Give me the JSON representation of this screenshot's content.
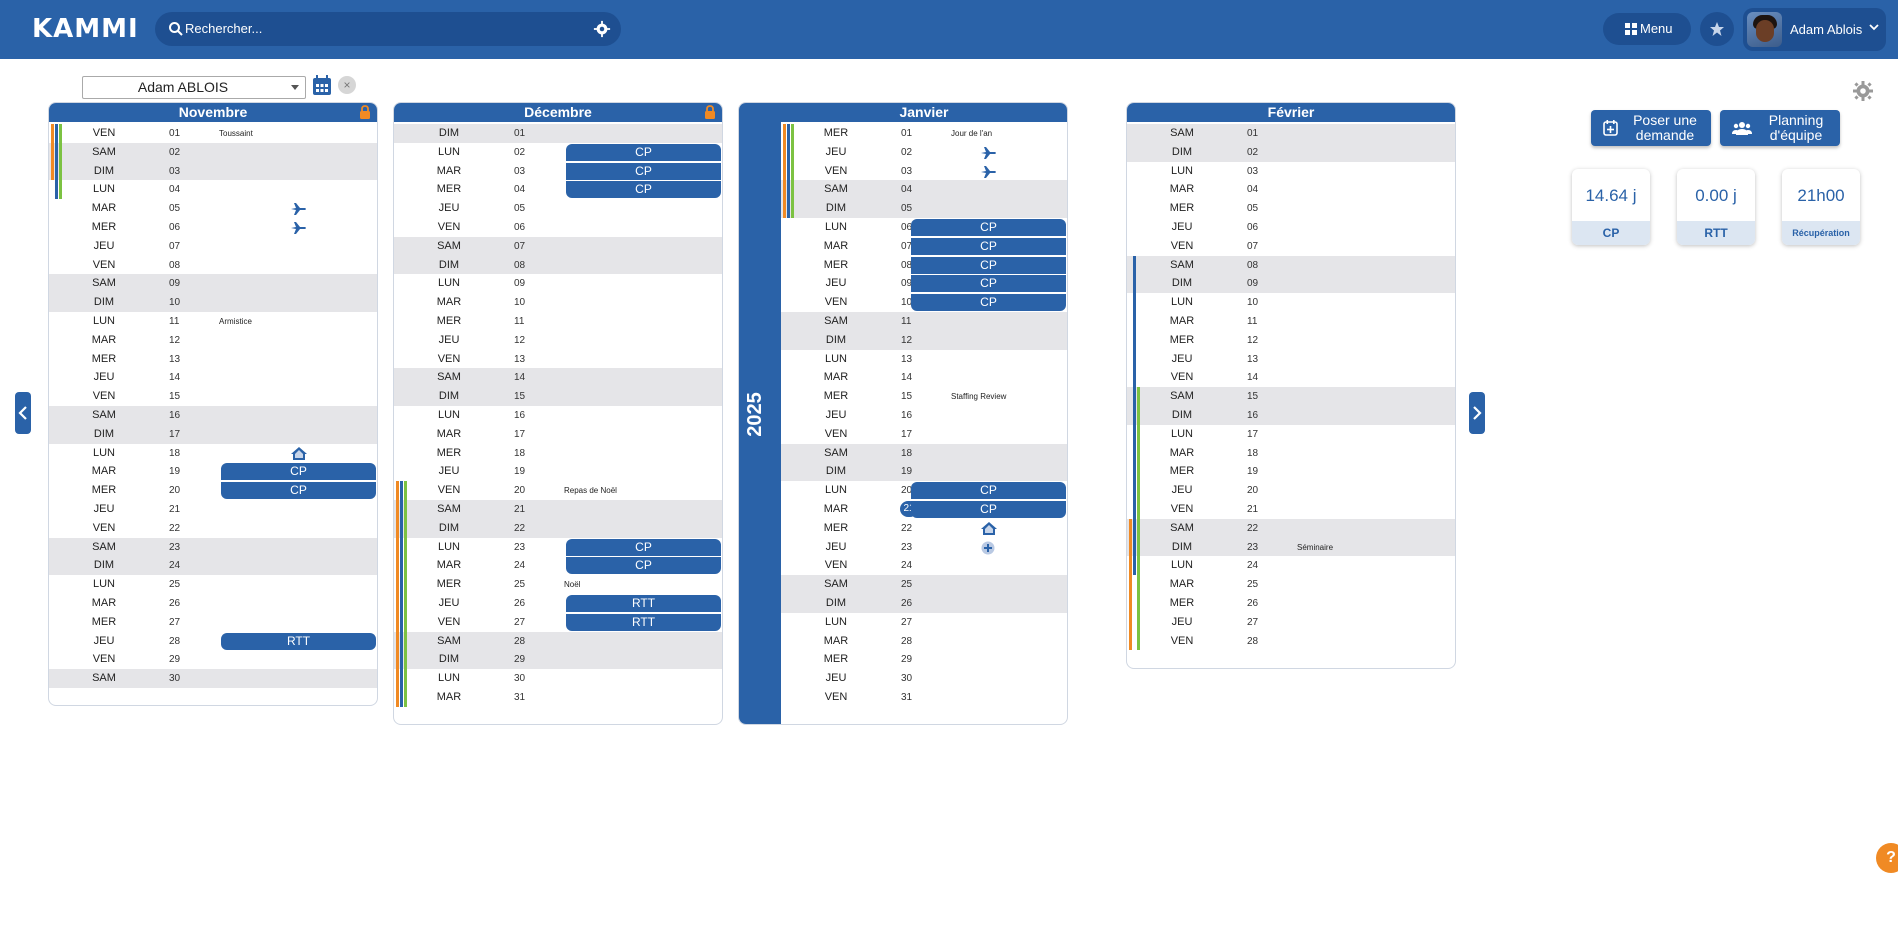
{
  "header": {
    "logo": "KAMMI",
    "search_placeholder": "Rechercher...",
    "menu_label": "Menu",
    "user_name": "Adam Ablois"
  },
  "controls": {
    "selected_person": "Adam ABLOIS"
  },
  "year_label": "2025",
  "months": [
    {
      "name": "Novembre",
      "locked": true,
      "days": [
        [
          "VEN",
          "01",
          "Toussaint"
        ],
        [
          "SAM",
          "02",
          ""
        ],
        [
          "DIM",
          "03",
          ""
        ],
        [
          "LUN",
          "04",
          ""
        ],
        [
          "MAR",
          "05",
          ""
        ],
        [
          "MER",
          "06",
          ""
        ],
        [
          "JEU",
          "07",
          ""
        ],
        [
          "VEN",
          "08",
          ""
        ],
        [
          "SAM",
          "09",
          ""
        ],
        [
          "DIM",
          "10",
          ""
        ],
        [
          "LUN",
          "11",
          "Armistice"
        ],
        [
          "MAR",
          "12",
          ""
        ],
        [
          "MER",
          "13",
          ""
        ],
        [
          "JEU",
          "14",
          ""
        ],
        [
          "VEN",
          "15",
          ""
        ],
        [
          "SAM",
          "16",
          ""
        ],
        [
          "DIM",
          "17",
          ""
        ],
        [
          "LUN",
          "18",
          ""
        ],
        [
          "MAR",
          "19",
          ""
        ],
        [
          "MER",
          "20",
          ""
        ],
        [
          "JEU",
          "21",
          ""
        ],
        [
          "VEN",
          "22",
          ""
        ],
        [
          "SAM",
          "23",
          ""
        ],
        [
          "DIM",
          "24",
          ""
        ],
        [
          "LUN",
          "25",
          ""
        ],
        [
          "MAR",
          "26",
          ""
        ],
        [
          "MER",
          "27",
          ""
        ],
        [
          "JEU",
          "28",
          ""
        ],
        [
          "VEN",
          "29",
          ""
        ],
        [
          "SAM",
          "30",
          ""
        ]
      ],
      "events": [
        {
          "start": 18,
          "end": 19,
          "labels": [
            "CP",
            "CP"
          ]
        },
        {
          "start": 27,
          "end": 27,
          "labels": [
            "RTT"
          ]
        }
      ],
      "icons": [
        {
          "row": 4,
          "type": "plane-icon"
        },
        {
          "row": 5,
          "type": "plane-icon"
        },
        {
          "row": 17,
          "type": "home-icon"
        }
      ]
    },
    {
      "name": "Décembre",
      "locked": true,
      "days": [
        [
          "DIM",
          "01",
          ""
        ],
        [
          "LUN",
          "02",
          ""
        ],
        [
          "MAR",
          "03",
          ""
        ],
        [
          "MER",
          "04",
          ""
        ],
        [
          "JEU",
          "05",
          ""
        ],
        [
          "VEN",
          "06",
          ""
        ],
        [
          "SAM",
          "07",
          ""
        ],
        [
          "DIM",
          "08",
          ""
        ],
        [
          "LUN",
          "09",
          ""
        ],
        [
          "MAR",
          "10",
          ""
        ],
        [
          "MER",
          "11",
          ""
        ],
        [
          "JEU",
          "12",
          ""
        ],
        [
          "VEN",
          "13",
          ""
        ],
        [
          "SAM",
          "14",
          ""
        ],
        [
          "DIM",
          "15",
          ""
        ],
        [
          "LUN",
          "16",
          ""
        ],
        [
          "MAR",
          "17",
          ""
        ],
        [
          "MER",
          "18",
          ""
        ],
        [
          "JEU",
          "19",
          ""
        ],
        [
          "VEN",
          "20",
          "Repas de Noël"
        ],
        [
          "SAM",
          "21",
          ""
        ],
        [
          "DIM",
          "22",
          ""
        ],
        [
          "LUN",
          "23",
          ""
        ],
        [
          "MAR",
          "24",
          ""
        ],
        [
          "MER",
          "25",
          "Noël"
        ],
        [
          "JEU",
          "26",
          ""
        ],
        [
          "VEN",
          "27",
          ""
        ],
        [
          "SAM",
          "28",
          ""
        ],
        [
          "DIM",
          "29",
          ""
        ],
        [
          "LUN",
          "30",
          ""
        ],
        [
          "MAR",
          "31",
          ""
        ]
      ],
      "events": [
        {
          "start": 1,
          "end": 3,
          "labels": [
            "CP",
            "CP",
            "CP"
          ]
        },
        {
          "start": 22,
          "end": 23,
          "labels": [
            "CP",
            "CP"
          ]
        },
        {
          "start": 25,
          "end": 26,
          "labels": [
            "RTT",
            "RTT"
          ]
        }
      ],
      "icons": []
    },
    {
      "name": "Janvier",
      "locked": false,
      "days": [
        [
          "MER",
          "01",
          "Jour de l'an"
        ],
        [
          "JEU",
          "02",
          ""
        ],
        [
          "VEN",
          "03",
          ""
        ],
        [
          "SAM",
          "04",
          ""
        ],
        [
          "DIM",
          "05",
          ""
        ],
        [
          "LUN",
          "06",
          ""
        ],
        [
          "MAR",
          "07",
          ""
        ],
        [
          "MER",
          "08",
          ""
        ],
        [
          "JEU",
          "09",
          ""
        ],
        [
          "VEN",
          "10",
          ""
        ],
        [
          "SAM",
          "11",
          ""
        ],
        [
          "DIM",
          "12",
          ""
        ],
        [
          "LUN",
          "13",
          ""
        ],
        [
          "MAR",
          "14",
          ""
        ],
        [
          "MER",
          "15",
          "Staffing Review"
        ],
        [
          "JEU",
          "16",
          ""
        ],
        [
          "VEN",
          "17",
          ""
        ],
        [
          "SAM",
          "18",
          ""
        ],
        [
          "DIM",
          "19",
          ""
        ],
        [
          "LUN",
          "20",
          ""
        ],
        [
          "MAR",
          "21",
          ""
        ],
        [
          "MER",
          "22",
          ""
        ],
        [
          "JEU",
          "23",
          ""
        ],
        [
          "VEN",
          "24",
          ""
        ],
        [
          "SAM",
          "25",
          ""
        ],
        [
          "DIM",
          "26",
          ""
        ],
        [
          "LUN",
          "27",
          ""
        ],
        [
          "MAR",
          "28",
          ""
        ],
        [
          "MER",
          "29",
          ""
        ],
        [
          "JEU",
          "30",
          ""
        ],
        [
          "VEN",
          "31",
          ""
        ]
      ],
      "events": [
        {
          "start": 5,
          "end": 9,
          "labels": [
            "CP",
            "CP",
            "CP",
            "CP",
            "CP"
          ]
        },
        {
          "start": 19,
          "end": 20,
          "labels": [
            "CP",
            "CP"
          ]
        }
      ],
      "icons": [
        {
          "row": 1,
          "type": "plane-icon"
        },
        {
          "row": 2,
          "type": "plane-icon"
        },
        {
          "row": 21,
          "type": "home-icon"
        },
        {
          "row": 22,
          "type": "plus-icon"
        }
      ],
      "today_row": 20
    },
    {
      "name": "Février",
      "locked": false,
      "days": [
        [
          "SAM",
          "01",
          ""
        ],
        [
          "DIM",
          "02",
          ""
        ],
        [
          "LUN",
          "03",
          ""
        ],
        [
          "MAR",
          "04",
          ""
        ],
        [
          "MER",
          "05",
          ""
        ],
        [
          "JEU",
          "06",
          ""
        ],
        [
          "VEN",
          "07",
          ""
        ],
        [
          "SAM",
          "08",
          ""
        ],
        [
          "DIM",
          "09",
          ""
        ],
        [
          "LUN",
          "10",
          ""
        ],
        [
          "MAR",
          "11",
          ""
        ],
        [
          "MER",
          "12",
          ""
        ],
        [
          "JEU",
          "13",
          ""
        ],
        [
          "VEN",
          "14",
          ""
        ],
        [
          "SAM",
          "15",
          ""
        ],
        [
          "DIM",
          "16",
          ""
        ],
        [
          "LUN",
          "17",
          ""
        ],
        [
          "MAR",
          "18",
          ""
        ],
        [
          "MER",
          "19",
          ""
        ],
        [
          "JEU",
          "20",
          ""
        ],
        [
          "VEN",
          "21",
          ""
        ],
        [
          "SAM",
          "22",
          ""
        ],
        [
          "DIM",
          "23",
          "Séminaire"
        ],
        [
          "LUN",
          "24",
          ""
        ],
        [
          "MAR",
          "25",
          ""
        ],
        [
          "MER",
          "26",
          ""
        ],
        [
          "JEU",
          "27",
          ""
        ],
        [
          "VEN",
          "28",
          ""
        ]
      ],
      "events": [],
      "icons": []
    }
  ],
  "actions": {
    "new_request": "Poser une demande",
    "team_planning": "Planning d'équipe"
  },
  "stats": [
    {
      "value": "14.64 j",
      "label": "CP"
    },
    {
      "value": "0.00 j",
      "label": "RTT"
    },
    {
      "value": "21h00",
      "label": "Récupération"
    }
  ],
  "help_label": "?",
  "colors": {
    "primary": "#2a62a8",
    "primary_dark": "#1e4f91",
    "weekend": "#e5e5e8",
    "lock": "#f08a24",
    "bar_orange": "#f08a24",
    "bar_green": "#7cc242",
    "bar_blue": "#2a62a8"
  }
}
